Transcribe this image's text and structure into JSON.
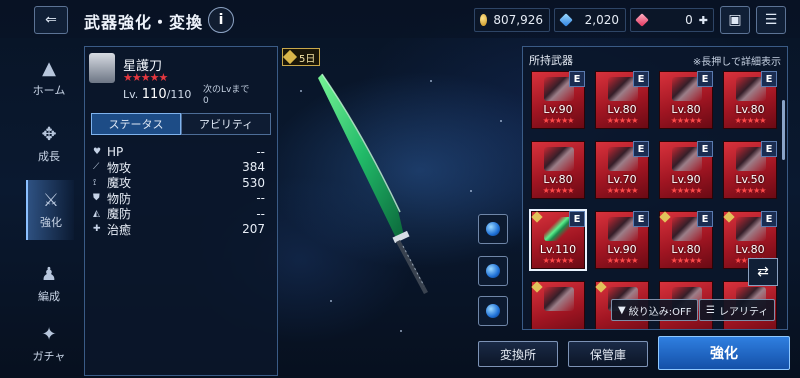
{
  "header": {
    "title": "武器強化・変換",
    "info_label": "i",
    "gil": "807,926",
    "crystal": "2,020",
    "gem": "0"
  },
  "sidenav": {
    "items": [
      {
        "label": "ホーム"
      },
      {
        "label": "成長"
      },
      {
        "label": "強化"
      },
      {
        "label": "編成"
      },
      {
        "label": "ガチャ"
      }
    ]
  },
  "weapon": {
    "name": "星護刀",
    "stars": "★★★★★",
    "lv_prefix": "Lv.",
    "lv_current": "110",
    "lv_max": "/110",
    "next_lv_label": "次のLvまで",
    "next_lv_value": "0",
    "lv_tag": "5日"
  },
  "tabs": {
    "status": "ステータス",
    "ability": "アビリティ"
  },
  "stats": [
    {
      "label": "HP",
      "value": "--"
    },
    {
      "label": "物攻",
      "value": "384"
    },
    {
      "label": "魔攻",
      "value": "530"
    },
    {
      "label": "物防",
      "value": "--"
    },
    {
      "label": "魔防",
      "value": "--"
    },
    {
      "label": "治癒",
      "value": "207"
    }
  ],
  "inventory": {
    "title": "所持武器",
    "hint": "※長押しで詳細表示",
    "e_label": "E",
    "stars": "★★★★★",
    "items": [
      {
        "lv": "Lv.90"
      },
      {
        "lv": "Lv.80"
      },
      {
        "lv": "Lv.80"
      },
      {
        "lv": "Lv.80"
      },
      {
        "lv": "Lv.80"
      },
      {
        "lv": "Lv.70"
      },
      {
        "lv": "Lv.90"
      },
      {
        "lv": "Lv.50"
      },
      {
        "lv": "Lv.110"
      },
      {
        "lv": "Lv.90"
      },
      {
        "lv": "Lv.80"
      },
      {
        "lv": "Lv.80"
      }
    ],
    "filter_label": "絞り込み:OFF",
    "sort_label": "レアリティ"
  },
  "buttons": {
    "exchange": "変換所",
    "storage": "保管庫",
    "enhance": "強化"
  },
  "colors": {
    "accent": "#2f7fe0",
    "rarity_red": "#d8323c",
    "star_red": "#e5373f"
  }
}
